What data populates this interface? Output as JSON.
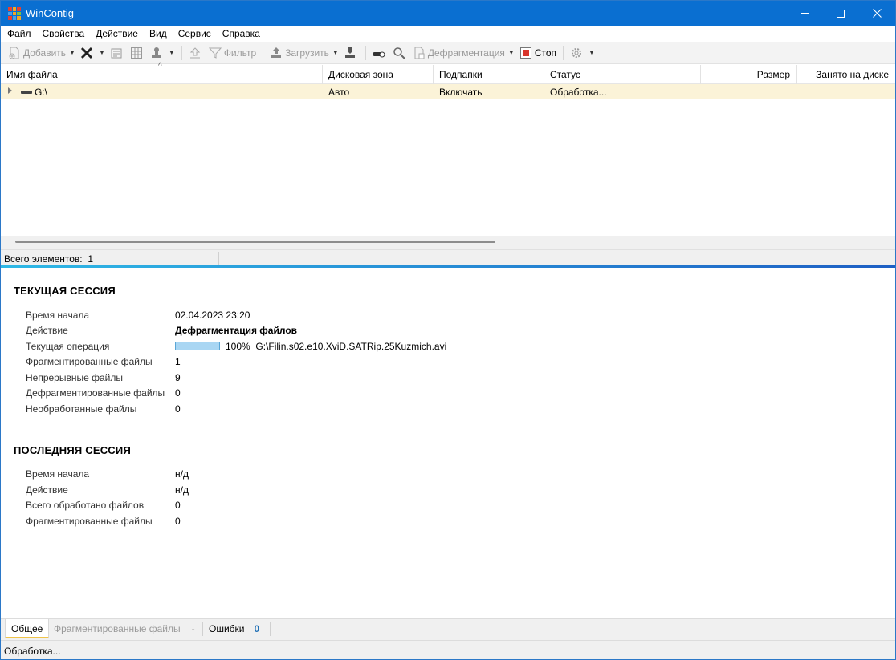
{
  "window": {
    "title": "WinContig"
  },
  "menu": [
    "Файл",
    "Свойства",
    "Действие",
    "Вид",
    "Сервис",
    "Справка"
  ],
  "toolbar": {
    "add_label": "Добавить",
    "filter_label": "Фильтр",
    "load_label": "Загрузить",
    "defrag_label": "Дефрагментация",
    "stop_label": "Стоп"
  },
  "grid": {
    "columns": [
      "Имя файла",
      "Дисковая зона",
      "Подпапки",
      "Статус",
      "Размер",
      "Занято на диске"
    ],
    "rows": [
      {
        "name": "G:\\",
        "zone": "Авто",
        "subfolders": "Включать",
        "status": "Обработка...",
        "size": "",
        "disk": ""
      }
    ],
    "total_label": "Всего элементов:",
    "total_count": "1"
  },
  "current_session": {
    "title": "ТЕКУЩАЯ СЕССИЯ",
    "start_label": "Время начала",
    "start_value": "02.04.2023 23:20",
    "action_label": "Действие",
    "action_value": "Дефрагментация файлов",
    "operation_label": "Текущая операция",
    "operation_percent": "100%",
    "operation_progress": 100,
    "operation_path": "G:\\Filin.s02.e10.XviD.SATRip.25Kuzmich.avi",
    "fragmented_label": "Фрагментированные файлы",
    "fragmented_value": "1",
    "contiguous_label": "Непрерывные файлы",
    "contiguous_value": "9",
    "defragmented_label": "Дефрагментированные файлы",
    "defragmented_value": "0",
    "unprocessed_label": "Необработанные файлы",
    "unprocessed_value": "0"
  },
  "last_session": {
    "title": "ПОСЛЕДНЯЯ СЕССИЯ",
    "start_label": "Время начала",
    "start_value": "н/д",
    "action_label": "Действие",
    "action_value": "н/д",
    "total_label": "Всего обработано файлов",
    "total_value": "0",
    "fragmented_label": "Фрагментированные файлы",
    "fragmented_value": "0"
  },
  "tabs": {
    "general": "Общее",
    "fragmented": "Фрагментированные файлы",
    "fragmented_count": "-",
    "errors": "Ошибки",
    "errors_count": "0"
  },
  "status": "Обработка...",
  "colors": {
    "titlebar": "#0a6fd1",
    "row_highlight": "#fbf3d8",
    "accent": "#1f6fb5"
  }
}
